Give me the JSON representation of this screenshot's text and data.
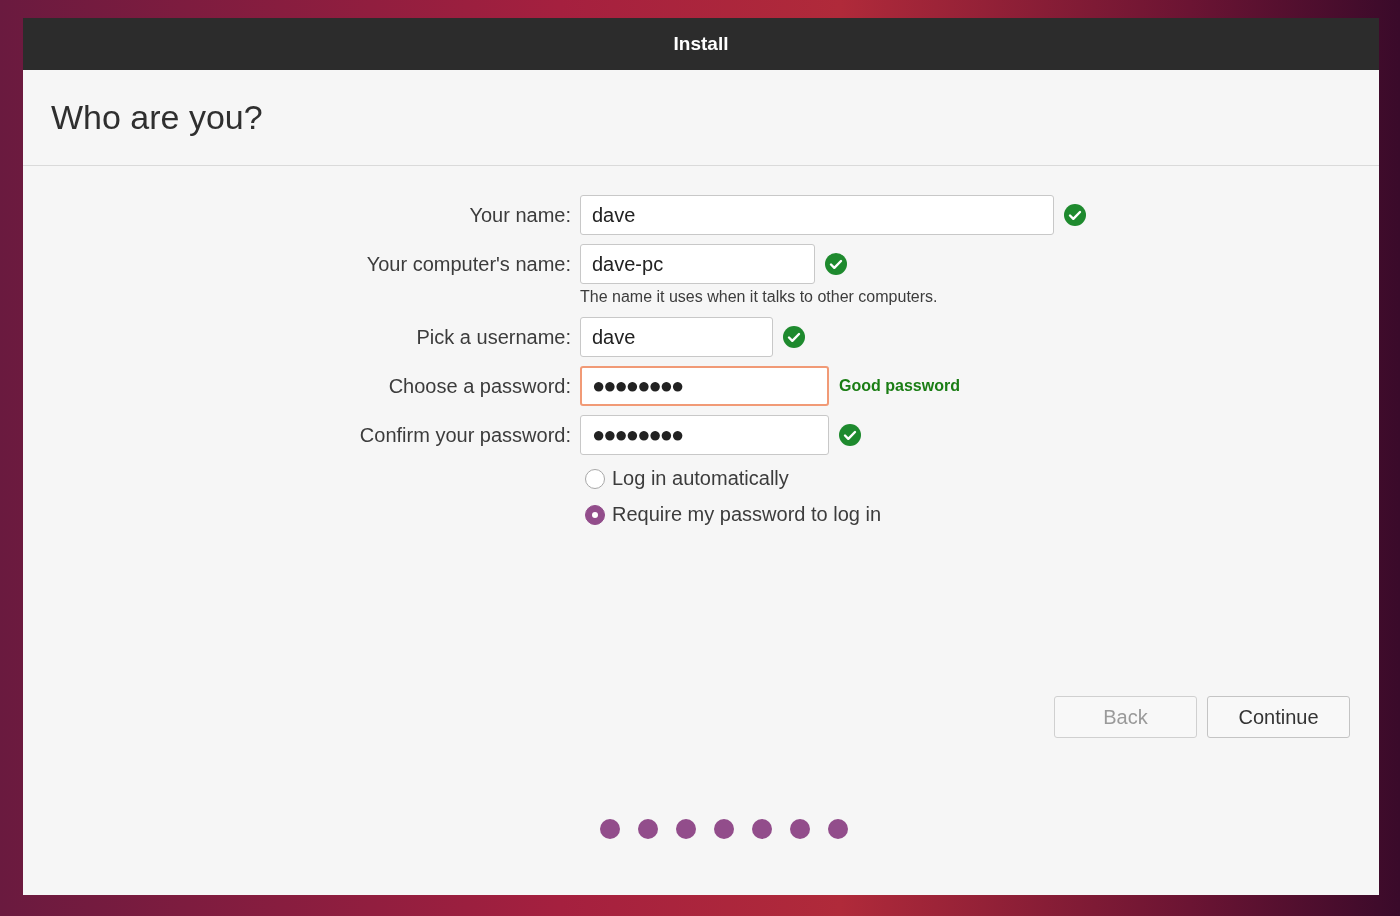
{
  "window": {
    "title": "Install"
  },
  "page_title": "Who are you?",
  "fields": [
    {
      "label": "Your name:",
      "value": "dave",
      "kind": "text",
      "valid": true,
      "focused": false
    },
    {
      "label": "Your computer's name:",
      "value": "dave-pc",
      "kind": "text",
      "valid": true,
      "focused": false,
      "hint": "The name it uses when it talks to other computers."
    },
    {
      "label": "Pick a username:",
      "value": "dave",
      "kind": "text",
      "valid": true,
      "focused": false
    },
    {
      "label": "Choose a password:",
      "value": "●●●●●●●●",
      "kind": "password",
      "valid": false,
      "focused": true,
      "strength": "Good password"
    },
    {
      "label": "Confirm your password:",
      "value": "●●●●●●●●",
      "kind": "password",
      "valid": true,
      "focused": false
    }
  ],
  "login_options": [
    {
      "label": "Log in automatically",
      "selected": false
    },
    {
      "label": "Require my password to log in",
      "selected": true
    }
  ],
  "buttons": [
    {
      "label": "Back",
      "disabled": true
    },
    {
      "label": "Continue",
      "disabled": false
    }
  ],
  "progress_dots": [
    {
      "done": true
    },
    {
      "done": true
    },
    {
      "done": true
    },
    {
      "done": true
    },
    {
      "done": true
    },
    {
      "done": true
    },
    {
      "done": true
    }
  ]
}
